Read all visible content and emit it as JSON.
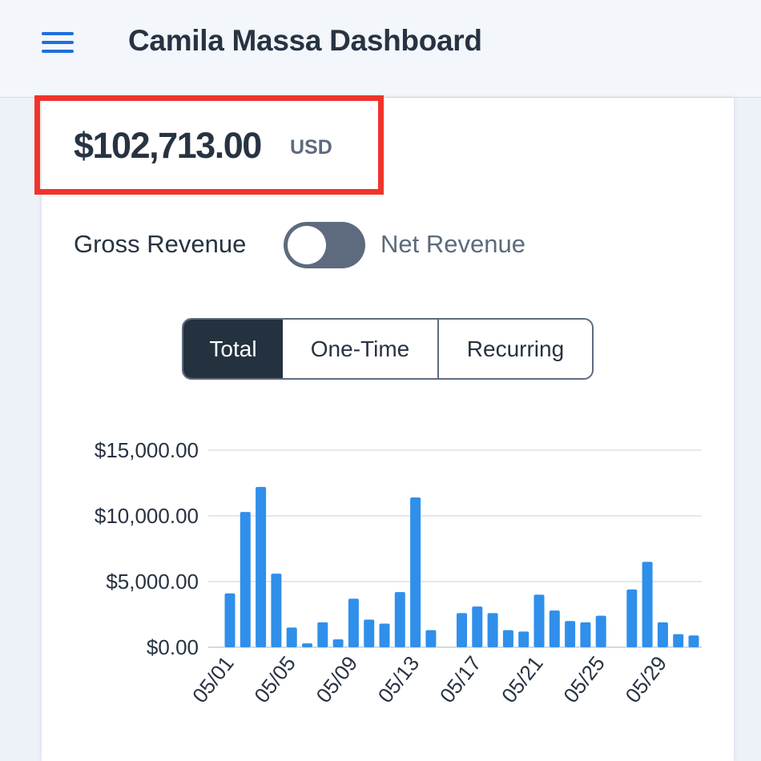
{
  "header": {
    "title": "Camila Massa Dashboard",
    "menu_icon": "hamburger-menu-icon"
  },
  "summary": {
    "amount": "$102,713.00",
    "currency": "USD"
  },
  "revenue_toggle": {
    "left_label": "Gross Revenue",
    "right_label": "Net Revenue",
    "state": "off"
  },
  "segments": {
    "items": [
      "Total",
      "One-Time",
      "Recurring"
    ],
    "selected": "Total"
  },
  "colors": {
    "accent": "#1f6fdc",
    "bar": "#2f8fea",
    "highlight": "#f1332b",
    "dark": "#24313f"
  },
  "chart_data": {
    "type": "bar",
    "categories": [
      "05/01",
      "05/02",
      "05/03",
      "05/04",
      "05/05",
      "05/06",
      "05/07",
      "05/08",
      "05/09",
      "05/10",
      "05/11",
      "05/12",
      "05/13",
      "05/14",
      "05/15",
      "05/16",
      "05/17",
      "05/18",
      "05/19",
      "05/20",
      "05/21",
      "05/22",
      "05/23",
      "05/24",
      "05/25",
      "05/26",
      "05/27",
      "05/28",
      "05/29",
      "05/30",
      "05/31"
    ],
    "values": [
      4100,
      10300,
      12200,
      5600,
      1500,
      300,
      1900,
      600,
      3700,
      2100,
      1800,
      4200,
      11400,
      1300,
      0,
      2600,
      3100,
      2600,
      1300,
      1200,
      4000,
      2800,
      2000,
      1900,
      2400,
      0,
      4400,
      6500,
      1900,
      1000,
      900
    ],
    "x_tick_labels": [
      "05/01",
      "05/05",
      "05/09",
      "05/13",
      "05/17",
      "05/21",
      "05/25",
      "05/29"
    ],
    "y_tick_labels": [
      "$0.00",
      "$5,000.00",
      "$10,000.00",
      "$15,000.00"
    ],
    "ylim": [
      0,
      15000
    ],
    "grid": true,
    "title": "",
    "xlabel": "",
    "ylabel": ""
  }
}
